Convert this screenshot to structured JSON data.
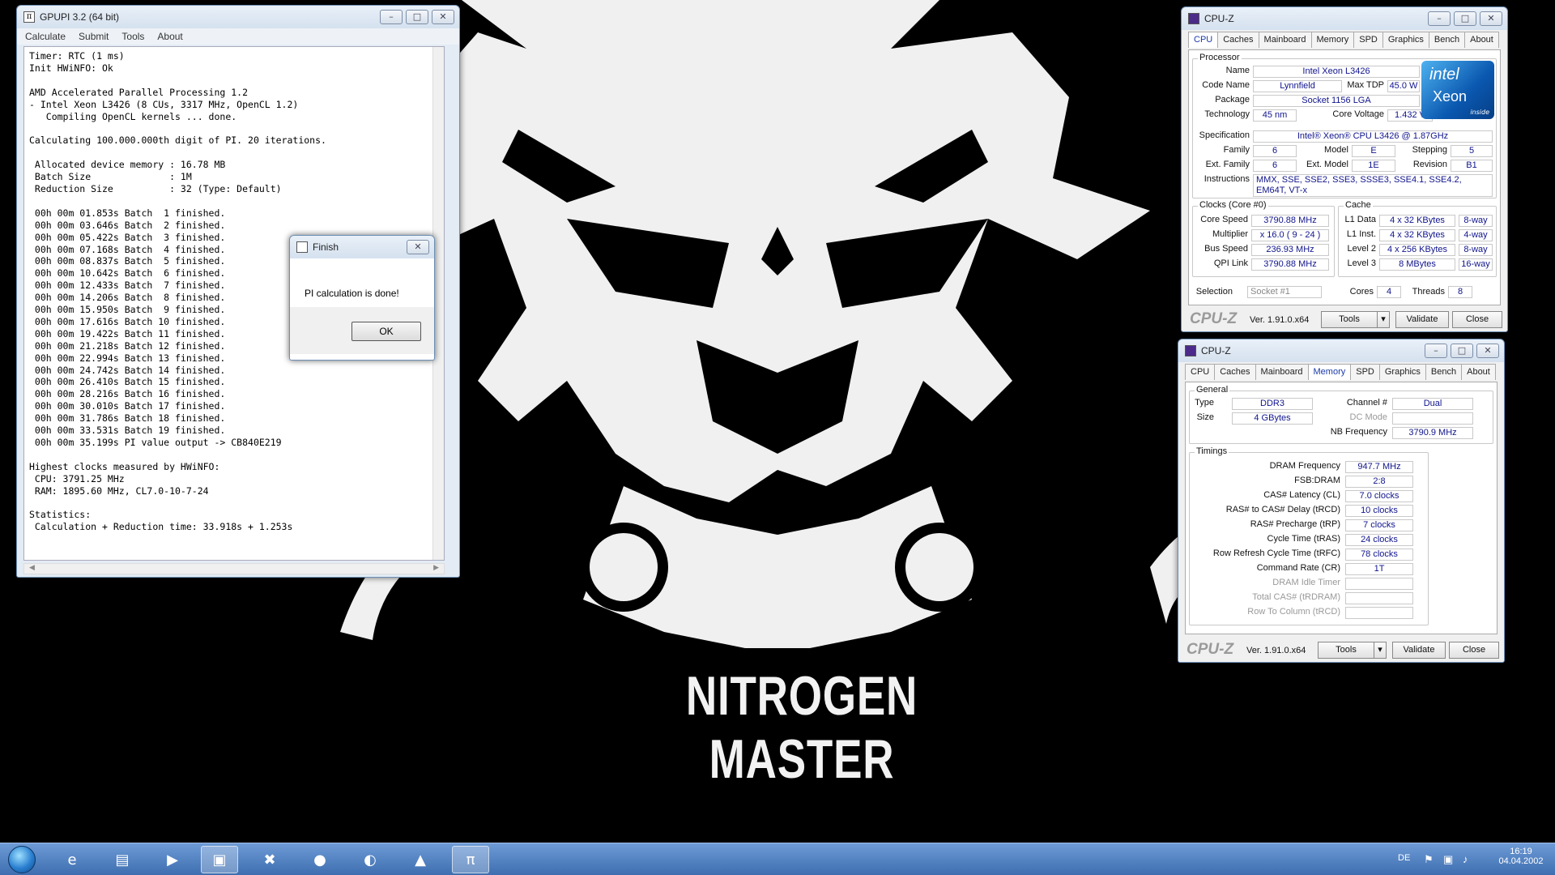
{
  "wallpaper": {
    "title": "NITROGEN MASTER"
  },
  "gpupi": {
    "title": "GPUPI 3.2 (64 bit)",
    "menu": [
      "Calculate",
      "Submit",
      "Tools",
      "About"
    ],
    "console_lines": [
      "Timer: RTC (1 ms)",
      "Init HWiNFO: Ok",
      "",
      "AMD Accelerated Parallel Processing 1.2",
      "- Intel Xeon L3426 (8 CUs, 3317 MHz, OpenCL 1.2)",
      "   Compiling OpenCL kernels ... done.",
      "",
      "Calculating 100.000.000th digit of PI. 20 iterations.",
      "",
      " Allocated device memory : 16.78 MB",
      " Batch Size              : 1M",
      " Reduction Size          : 32 (Type: Default)",
      "",
      " 00h 00m 01.853s Batch  1 finished.",
      " 00h 00m 03.646s Batch  2 finished.",
      " 00h 00m 05.422s Batch  3 finished.",
      " 00h 00m 07.168s Batch  4 finished.",
      " 00h 00m 08.837s Batch  5 finished.",
      " 00h 00m 10.642s Batch  6 finished.",
      " 00h 00m 12.433s Batch  7 finished.",
      " 00h 00m 14.206s Batch  8 finished.",
      " 00h 00m 15.950s Batch  9 finished.",
      " 00h 00m 17.616s Batch 10 finished.",
      " 00h 00m 19.422s Batch 11 finished.",
      " 00h 00m 21.218s Batch 12 finished.",
      " 00h 00m 22.994s Batch 13 finished.",
      " 00h 00m 24.742s Batch 14 finished.",
      " 00h 00m 26.410s Batch 15 finished.",
      " 00h 00m 28.216s Batch 16 finished.",
      " 00h 00m 30.010s Batch 17 finished.",
      " 00h 00m 31.786s Batch 18 finished.",
      " 00h 00m 33.531s Batch 19 finished.",
      " 00h 00m 35.199s PI value output -> CB840E219",
      "",
      "Highest clocks measured by HWiNFO:",
      " CPU: 3791.25 MHz",
      " RAM: 1895.60 MHz, CL7.0-10-7-24",
      "",
      "Statistics:",
      " Calculation + Reduction time: 33.918s + 1.253s"
    ]
  },
  "finish": {
    "title": "Finish",
    "message": "PI calculation is done!",
    "ok": "OK"
  },
  "cpuz_cpu": {
    "title": "CPU-Z",
    "tabs": [
      "CPU",
      "Caches",
      "Mainboard",
      "Memory",
      "SPD",
      "Graphics",
      "Bench",
      "About"
    ],
    "active_tab": "CPU",
    "processor_label": "Processor",
    "fields": {
      "name_label": "Name",
      "name": "Intel Xeon L3426",
      "codename_label": "Code Name",
      "codename": "Lynnfield",
      "maxtdp_label": "Max TDP",
      "maxtdp": "45.0 W",
      "package_label": "Package",
      "package": "Socket 1156 LGA",
      "technology_label": "Technology",
      "technology": "45 nm",
      "corevoltage_label": "Core Voltage",
      "corevoltage": "1.432 V",
      "spec_label": "Specification",
      "spec": "Intel® Xeon® CPU          L3426  @ 1.87GHz",
      "family_label": "Family",
      "family": "6",
      "model_label": "Model",
      "model": "E",
      "stepping_label": "Stepping",
      "stepping": "5",
      "extfamily_label": "Ext. Family",
      "extfamily": "6",
      "extmodel_label": "Ext. Model",
      "extmodel": "1E",
      "revision_label": "Revision",
      "revision": "B1",
      "instructions_label": "Instructions",
      "instructions": "MMX, SSE, SSE2, SSE3, SSSE3, SSE4.1, SSE4.2, EM64T, VT-x"
    },
    "logo": {
      "brand": "intel",
      "line": "Xeon",
      "tag": "inside"
    },
    "clocks": {
      "label": "Clocks (Core #0)",
      "corespeed_label": "Core Speed",
      "corespeed": "3790.88 MHz",
      "multiplier_label": "Multiplier",
      "multiplier": "x 16.0 ( 9 - 24 )",
      "busspeed_label": "Bus Speed",
      "busspeed": "236.93 MHz",
      "qpi_label": "QPI Link",
      "qpi": "3790.88 MHz"
    },
    "cache": {
      "label": "Cache",
      "rows": [
        {
          "name": "L1 Data",
          "size": "4 x 32 KBytes",
          "way": "8-way"
        },
        {
          "name": "L1 Inst.",
          "size": "4 x 32 KBytes",
          "way": "4-way"
        },
        {
          "name": "Level 2",
          "size": "4 x 256 KBytes",
          "way": "8-way"
        },
        {
          "name": "Level 3",
          "size": "8 MBytes",
          "way": "16-way"
        }
      ]
    },
    "selection_label": "Selection",
    "selection": "Socket #1",
    "cores_label": "Cores",
    "cores": "4",
    "threads_label": "Threads",
    "threads": "8",
    "footer": {
      "brand": "CPU-Z",
      "version": "Ver. 1.91.0.x64",
      "tools": "Tools",
      "validate": "Validate",
      "close": "Close"
    }
  },
  "cpuz_mem": {
    "title": "CPU-Z",
    "tabs": [
      "CPU",
      "Caches",
      "Mainboard",
      "Memory",
      "SPD",
      "Graphics",
      "Bench",
      "About"
    ],
    "active_tab": "Memory",
    "general": {
      "label": "General",
      "type_label": "Type",
      "type": "DDR3",
      "size_label": "Size",
      "size": "4 GBytes",
      "channel_label": "Channel #",
      "channel": "Dual",
      "dcmode_label": "DC Mode",
      "dcmode": "",
      "nbfreq_label": "NB Frequency",
      "nbfreq": "3790.9 MHz"
    },
    "timings": {
      "label": "Timings",
      "rows": [
        {
          "name": "DRAM Frequency",
          "value": "947.7 MHz",
          "dim": false
        },
        {
          "name": "FSB:DRAM",
          "value": "2:8",
          "dim": false
        },
        {
          "name": "CAS# Latency (CL)",
          "value": "7.0 clocks",
          "dim": false
        },
        {
          "name": "RAS# to CAS# Delay (tRCD)",
          "value": "10 clocks",
          "dim": false
        },
        {
          "name": "RAS# Precharge (tRP)",
          "value": "7 clocks",
          "dim": false
        },
        {
          "name": "Cycle Time (tRAS)",
          "value": "24 clocks",
          "dim": false
        },
        {
          "name": "Row Refresh Cycle Time (tRFC)",
          "value": "78 clocks",
          "dim": false
        },
        {
          "name": "Command Rate (CR)",
          "value": "1T",
          "dim": false
        },
        {
          "name": "DRAM Idle Timer",
          "value": "",
          "dim": true
        },
        {
          "name": "Total CAS# (tRDRAM)",
          "value": "",
          "dim": true
        },
        {
          "name": "Row To Column (tRCD)",
          "value": "",
          "dim": true
        }
      ]
    },
    "footer": {
      "brand": "CPU-Z",
      "version": "Ver. 1.91.0.x64",
      "tools": "Tools",
      "validate": "Validate",
      "close": "Close"
    }
  },
  "taskbar": {
    "items": [
      {
        "name": "internet-explorer-icon",
        "glyph": "e"
      },
      {
        "name": "file-explorer-icon",
        "glyph": "▤"
      },
      {
        "name": "media-player-icon",
        "glyph": "▶"
      },
      {
        "name": "cpuz-taskbar-icon",
        "glyph": "▣"
      },
      {
        "name": "hwinfo-icon",
        "glyph": "✖"
      },
      {
        "name": "blue-orb-icon",
        "glyph": "●"
      },
      {
        "name": "dark-orb-icon",
        "glyph": "◐"
      },
      {
        "name": "tank-icon",
        "glyph": "▲"
      },
      {
        "name": "gpupi-taskbar-icon",
        "glyph": "π"
      }
    ],
    "language": "DE",
    "time": "16:19",
    "date": "04.04.2002"
  }
}
